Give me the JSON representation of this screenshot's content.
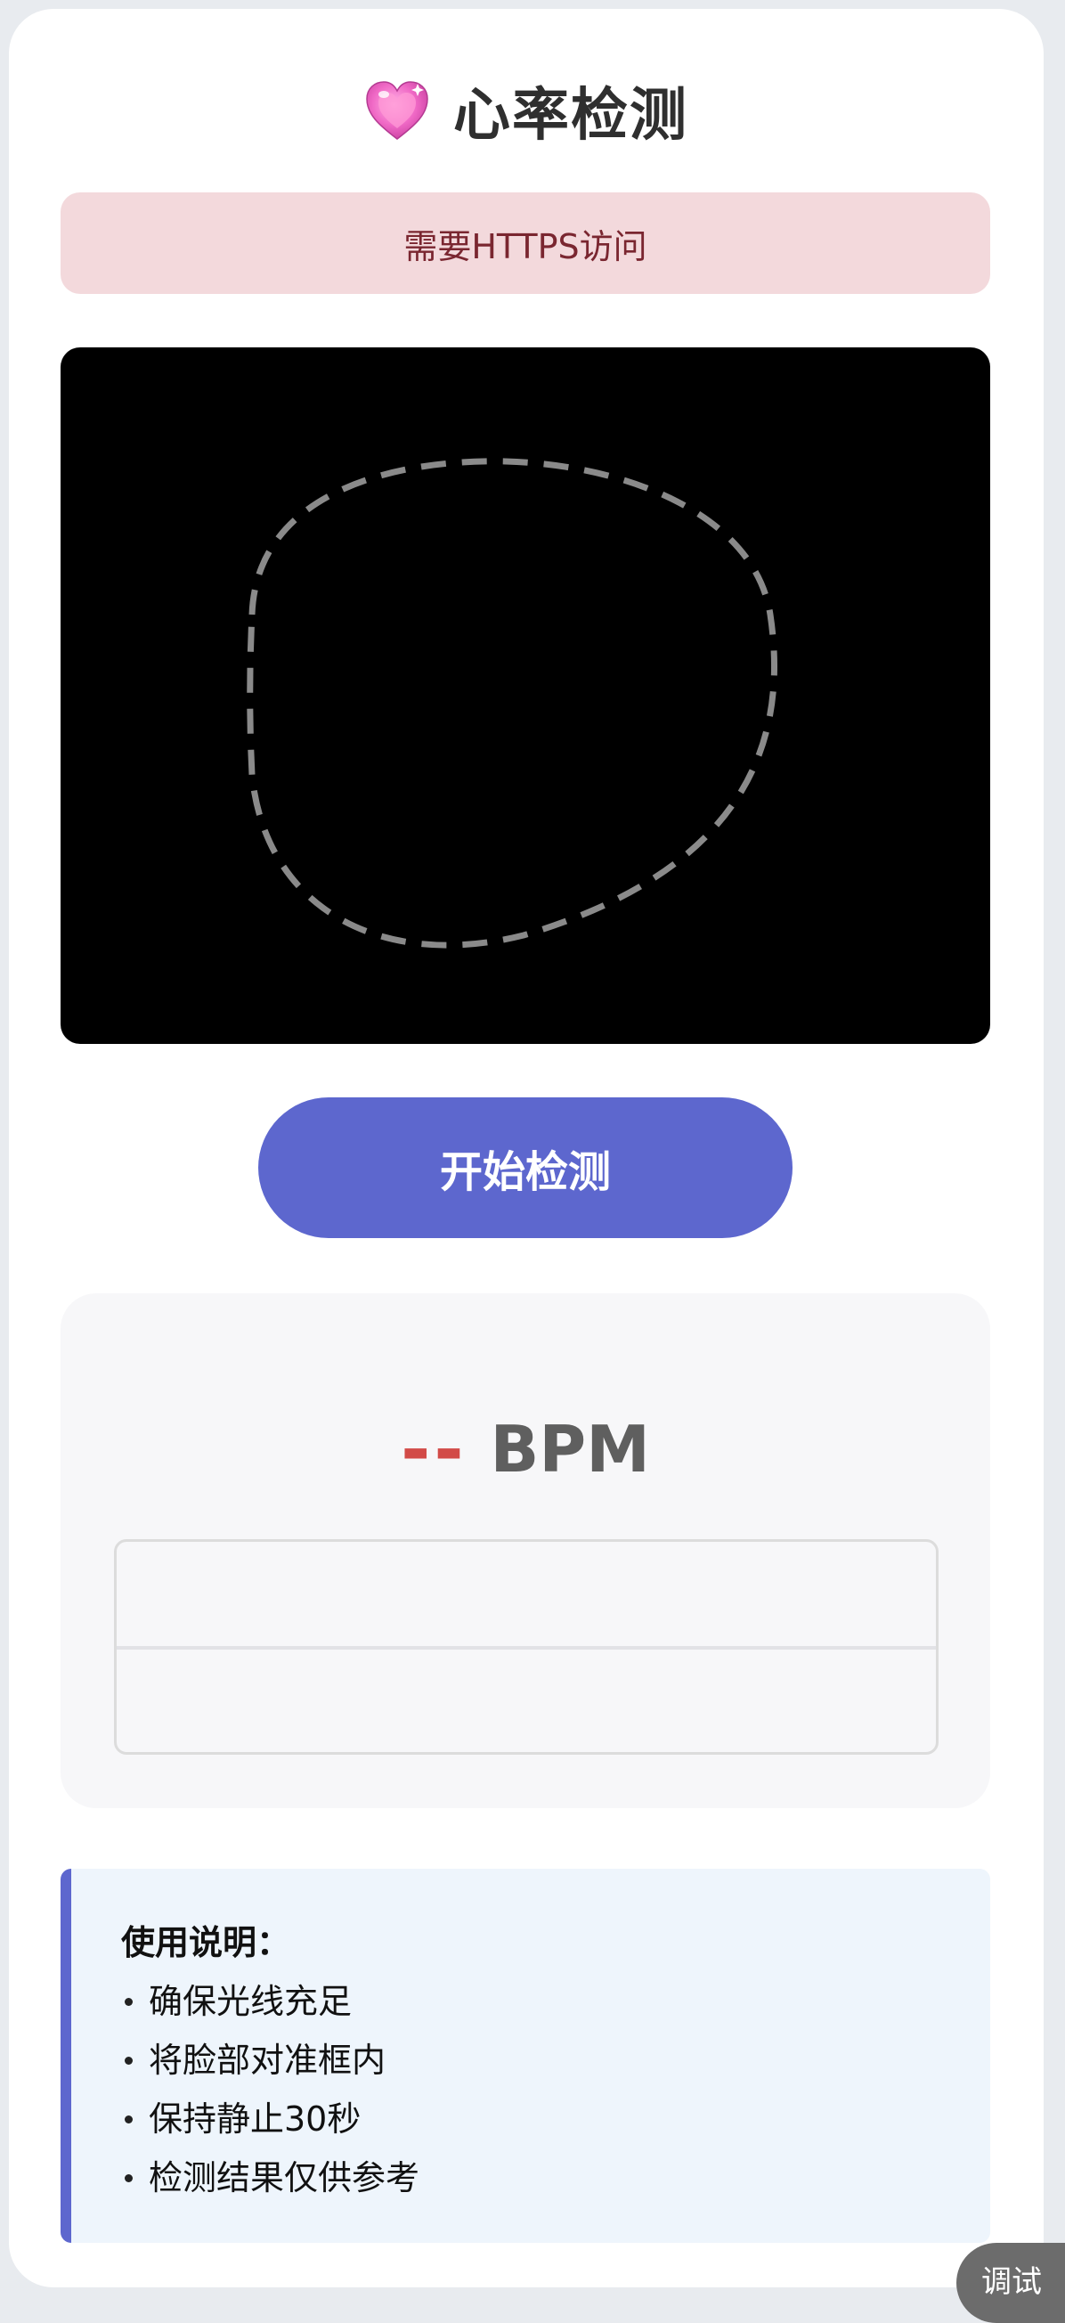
{
  "header": {
    "title": "心率检测",
    "icon": "sparkling-heart-icon"
  },
  "alert": {
    "message": "需要HTTPS访问"
  },
  "video": {
    "guide": "dashed-face-outline"
  },
  "controls": {
    "start_label": "开始检测"
  },
  "result": {
    "bpm_value": "--",
    "bpm_unit": "BPM"
  },
  "instructions": {
    "title": "使用说明：",
    "items": [
      "确保光线充足",
      "将脸部对准框内",
      "保持静止30秒",
      "检测结果仅供参考"
    ]
  },
  "debug": {
    "label": "调试"
  },
  "colors": {
    "accent": "#5d67ce",
    "alert_bg": "#f3d9dc",
    "alert_text": "#7a2630",
    "bpm_value": "#d24a47"
  }
}
